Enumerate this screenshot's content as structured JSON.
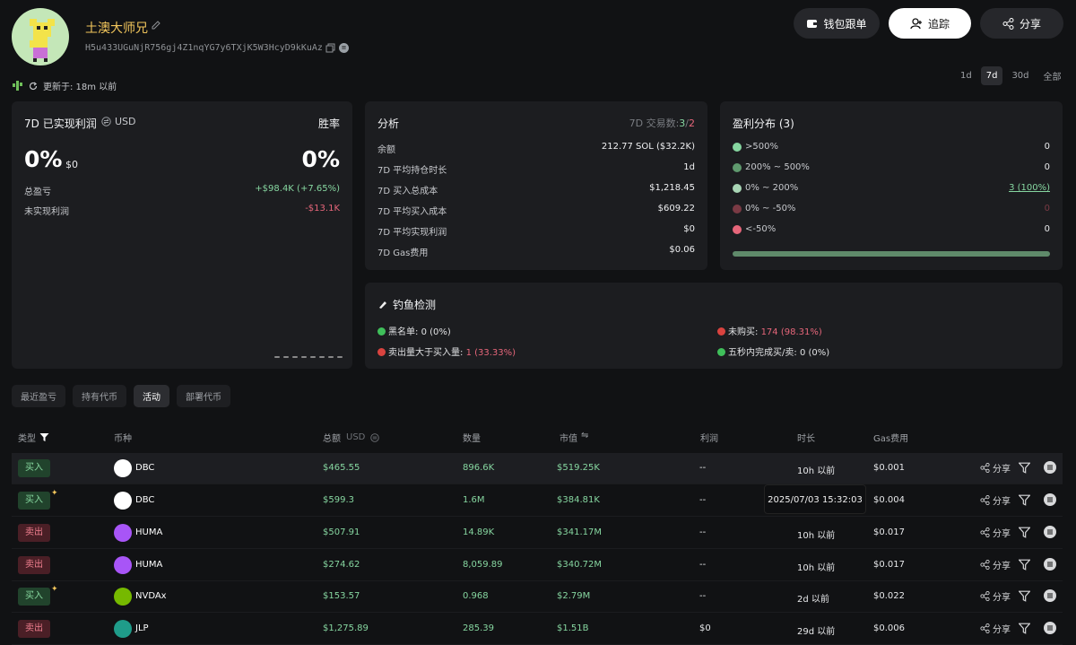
{
  "profile": {
    "name": "土澳大师兄",
    "address": "H5u433UGuNjR756gj4Z1nqYG7y6TXjK5W3HcyD9kKuAz",
    "updated": "更新于: 18m 以前"
  },
  "header": {
    "wallet_btn": "钱包跟单",
    "follow_btn": "追踪",
    "share_btn": "分享"
  },
  "timeframes": [
    "1d",
    "7d",
    "30d",
    "全部"
  ],
  "pnl": {
    "title": "7D 已实现利润",
    "currency": "USD",
    "winrate_label": "胜率",
    "pnl_pct": "0%",
    "pnl_usd": "$0",
    "winrate": "0%",
    "total_label": "总盈亏",
    "total_value": "+$98.4K (+7.65%)",
    "unreal_label": "未实现利润",
    "unreal_value": "-$13.1K"
  },
  "analysis": {
    "title": "分析",
    "trades_label": "7D 交易数:",
    "trades_buy": "3",
    "trades_sep": "/",
    "trades_sell": "2",
    "rows": [
      {
        "label": "余额",
        "value": "212.77 SOL ($32.2K)"
      },
      {
        "label": "7D 平均持仓时长",
        "value": "1d"
      },
      {
        "label": "7D 买入总成本",
        "value": "$1,218.45"
      },
      {
        "label": "7D 平均买入成本",
        "value": "$609.22"
      },
      {
        "label": "7D 平均实现利润",
        "value": "$0"
      },
      {
        "label": "7D Gas费用",
        "value": "$0.06"
      }
    ]
  },
  "distribution": {
    "title": "盈利分布 (3)",
    "rows": [
      {
        "label": ">500%",
        "value": "0",
        "color": "#86d6a0"
      },
      {
        "label": "200% ~ 500%",
        "value": "0",
        "color": "#5f9a6e"
      },
      {
        "label": "0% ~ 200%",
        "value": "3 (100%)",
        "color": "#a8d5b5"
      },
      {
        "label": "0% ~ -50%",
        "value": "0",
        "color": "#7a3a44"
      },
      {
        "label": "<-50%",
        "value": "0",
        "color": "#e6667a"
      }
    ]
  },
  "phishing": {
    "title": "钓鱼检测",
    "items": [
      {
        "label": "黑名单:",
        "value": "0 (0%)",
        "color": "#3fbf5a"
      },
      {
        "label": "未购买:",
        "value": "174 (98.31%)",
        "color": "#d9433f"
      },
      {
        "label": "卖出量大于买入量:",
        "value": "1 (33.33%)",
        "color": "#d9433f"
      },
      {
        "label": "五秒内完成买/卖:",
        "value": "0 (0%)",
        "color": "#3fbf5a"
      }
    ]
  },
  "tabs": [
    "最近盈亏",
    "持有代币",
    "活动",
    "部署代币"
  ],
  "columns": {
    "type": "类型",
    "token": "币种",
    "total": "总额",
    "total_unit": "USD",
    "qty": "数量",
    "mcap": "市值",
    "profit": "利润",
    "age": "时长",
    "gas": "Gas费用"
  },
  "share_label": "分享",
  "tooltip": "2025/07/03 15:32:03",
  "rows": [
    {
      "type": "买入",
      "side": "buy",
      "token": "DBC",
      "total": "$465.55",
      "qty": "896.6K",
      "mcap": "$519.25K",
      "profit": "--",
      "age": "10h 以前",
      "gas": "$0.001",
      "tok_color": "#ffffff"
    },
    {
      "type": "买入",
      "side": "buy",
      "token": "DBC",
      "total": "$599.3",
      "qty": "1.6M",
      "mcap": "$384.81K",
      "profit": "--",
      "age": "",
      "gas": "$0.004",
      "tok_color": "#ffffff"
    },
    {
      "type": "卖出",
      "side": "sell",
      "token": "HUMA",
      "total": "$507.91",
      "qty": "14.89K",
      "mcap": "$341.17M",
      "profit": "--",
      "age": "10h 以前",
      "gas": "$0.017",
      "tok_color": "#a855f7"
    },
    {
      "type": "卖出",
      "side": "sell",
      "token": "HUMA",
      "total": "$274.62",
      "qty": "8,059.89",
      "mcap": "$340.72M",
      "profit": "--",
      "age": "10h 以前",
      "gas": "$0.017",
      "tok_color": "#a855f7"
    },
    {
      "type": "买入",
      "side": "buy",
      "token": "NVDAx",
      "total": "$153.57",
      "qty": "0.968",
      "mcap": "$2.79M",
      "profit": "--",
      "age": "2d 以前",
      "gas": "$0.022",
      "tok_color": "#76b900"
    },
    {
      "type": "卖出",
      "side": "sell",
      "token": "JLP",
      "total": "$1,275.89",
      "qty": "285.39",
      "mcap": "$1.51B",
      "profit": "$0",
      "age": "29d 以前",
      "gas": "$0.006",
      "tok_color": "#1f9c8a"
    }
  ]
}
